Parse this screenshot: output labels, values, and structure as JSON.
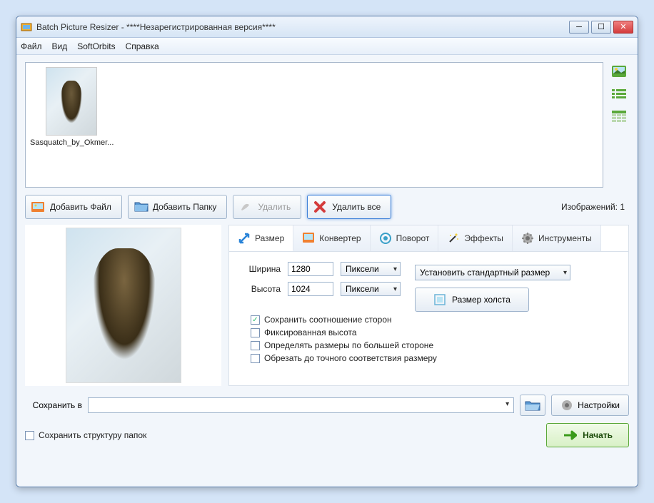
{
  "window": {
    "title": "Batch Picture Resizer - ****Незарегистрированная версия****"
  },
  "menu": {
    "file": "Файл",
    "view": "Вид",
    "softorbits": "SoftOrbits",
    "help": "Справка"
  },
  "thumbnail": {
    "label": "Sasquatch_by_Okmer..."
  },
  "toolbar": {
    "add_file": "Добавить Файл",
    "add_folder": "Добавить Папку",
    "delete": "Удалить",
    "delete_all": "Удалить все",
    "count_label": "Изображений: 1"
  },
  "tabs": {
    "size": "Размер",
    "converter": "Конвертер",
    "rotate": "Поворот",
    "effects": "Эффекты",
    "tools": "Инструменты"
  },
  "size_tab": {
    "width_label": "Ширина",
    "width_value": "1280",
    "height_label": "Высота",
    "height_value": "1024",
    "unit": "Пиксели",
    "standard_size": "Установить стандартный размер",
    "canvas_size": "Размер холста",
    "keep_ratio": "Сохранить соотношение сторон",
    "fixed_height": "Фиксированная высота",
    "detect_by_long": "Определять размеры по большей стороне",
    "crop_exact": "Обрезать до точного соответствия размеру",
    "keep_ratio_checked": true,
    "fixed_height_checked": false,
    "detect_by_long_checked": false,
    "crop_exact_checked": false
  },
  "save": {
    "label": "Сохранить в",
    "path": "",
    "settings": "Настройки",
    "keep_structure": "Сохранить структуру папок",
    "keep_structure_checked": false,
    "start": "Начать"
  }
}
